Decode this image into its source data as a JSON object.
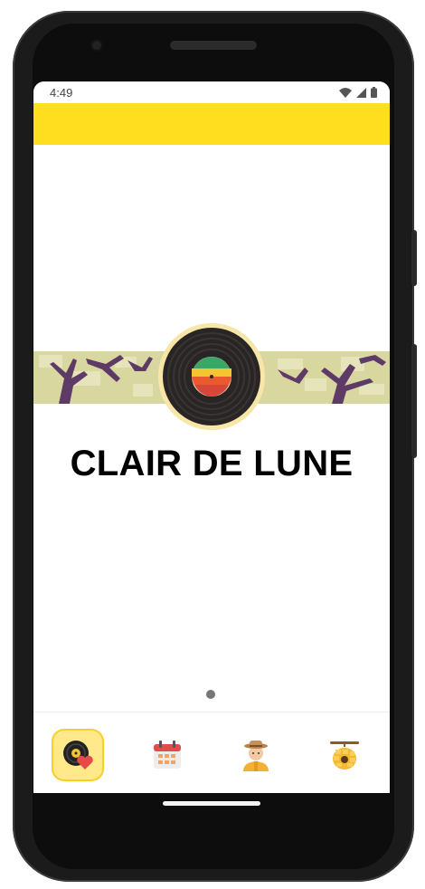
{
  "status_bar": {
    "time": "4:49",
    "icons": [
      "wifi-icon",
      "signal-icon",
      "battery-icon"
    ]
  },
  "app_bar": {
    "color": "#FFDD1F"
  },
  "track": {
    "title": "CLAIR DE LUNE",
    "record_icon": "vinyl-record-icon"
  },
  "pager": {
    "current_page": 1,
    "total_pages": 1
  },
  "bottom_nav": {
    "items": [
      {
        "name": "music",
        "icon": "vinyl-heart-icon",
        "active": true
      },
      {
        "name": "calendar",
        "icon": "calendar-icon",
        "active": false
      },
      {
        "name": "farmer",
        "icon": "farmer-icon",
        "active": false
      },
      {
        "name": "beehive",
        "icon": "beehive-icon",
        "active": false
      }
    ]
  },
  "colors": {
    "accent": "#FFDD1F",
    "nav_active_bg": "#FFE98A",
    "banner_bg": "#DCDBA9",
    "tree": "#5E3A66"
  }
}
